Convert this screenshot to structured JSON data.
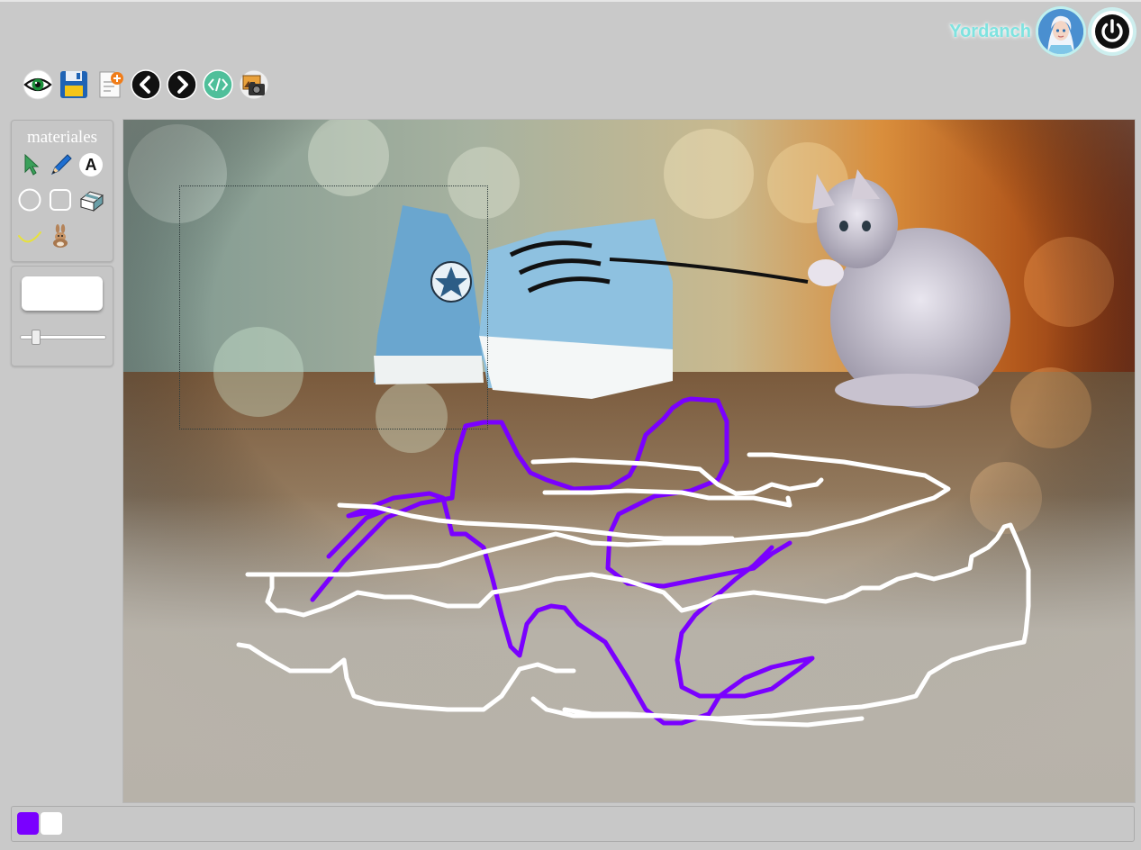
{
  "user": {
    "name": "Yordanch"
  },
  "toolbar": {
    "icons": [
      "eye-icon",
      "save-icon",
      "new-page-icon",
      "back-icon",
      "forward-icon",
      "code-icon",
      "photo-camera-icon"
    ]
  },
  "tools_panel": {
    "title": "materiales",
    "text_tool_label": "A",
    "tools": [
      "pointer-icon",
      "pencil-icon",
      "text-icon",
      "circle-icon",
      "rounded-rect-icon",
      "eraser-icon",
      "line-icon",
      "stamp-icon"
    ]
  },
  "color_panel": {
    "current_color": "#ffffff",
    "stroke_size_fraction": 0.18
  },
  "palette": {
    "swatches": [
      "#7a00ff",
      "#ffffff"
    ]
  },
  "canvas": {
    "background_image": "kitten-and-sneakers-photo",
    "stroke_colors": [
      "#7a00ff",
      "#ffffff"
    ]
  }
}
